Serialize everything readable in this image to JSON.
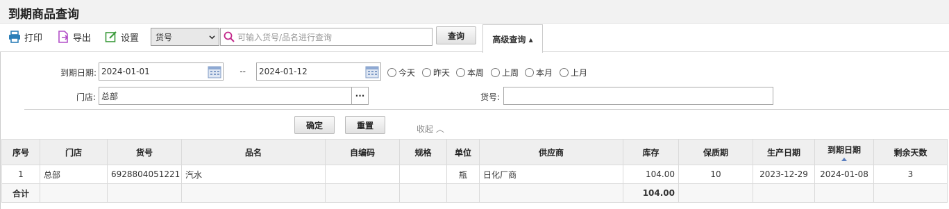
{
  "page_title": "到期商品查询",
  "toolbar": {
    "print": "打印",
    "export": "导出",
    "settings": "设置",
    "field_select": "货号",
    "search_placeholder": "可输入货号/品名进行查询",
    "query": "查询",
    "advanced": "高级查询 ▴"
  },
  "filters": {
    "expiry_label": "到期日期:",
    "date_from": "2024-01-01",
    "range_sep": "--",
    "date_to": "2024-01-12",
    "quick_ranges": [
      "今天",
      "昨天",
      "本周",
      "上周",
      "本月",
      "上月"
    ],
    "store_label": "门店:",
    "store_value": "总部",
    "store_more": "···",
    "sku_label": "货号:",
    "sku_value": "",
    "confirm": "确定",
    "reset": "重置",
    "collapse": "收起 ︿"
  },
  "table": {
    "headers": [
      "序号",
      "门店",
      "货号",
      "品名",
      "自编码",
      "规格",
      "单位",
      "供应商",
      "库存",
      "保质期",
      "生产日期",
      "到期日期",
      "剩余天数"
    ],
    "rows": [
      [
        "1",
        "总部",
        "6928804051221",
        "汽水",
        "",
        "",
        "瓶",
        "日化厂商",
        "104.00",
        "10",
        "2023-12-29",
        "2024-01-08",
        "3"
      ]
    ],
    "total_label": "合计",
    "total_stock": "104.00"
  }
}
